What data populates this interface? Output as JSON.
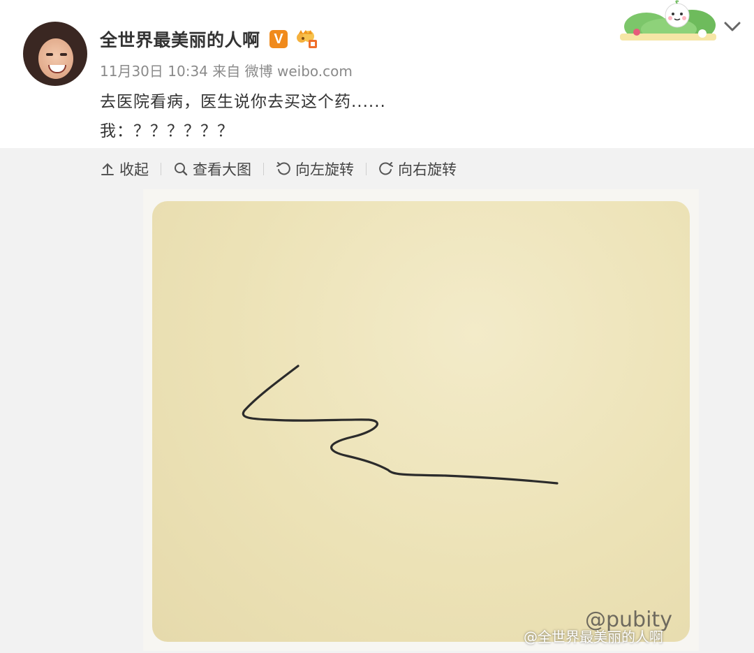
{
  "post": {
    "author_name": "全世界最美丽的人啊",
    "verified_badge": "V",
    "timestamp": "11月30日 10:34",
    "source": "来自 微博 weibo.com",
    "text_line1": "去医院看病，医生说你去买这个药......",
    "text_line2": "我：？？？？？？"
  },
  "toolbar": {
    "collapse_label": "收起",
    "view_large_label": "查看大图",
    "rotate_left_label": "向左旋转",
    "rotate_right_label": "向右旋转"
  },
  "image": {
    "watermark_pubity": "@pubity",
    "watermark_weibo": "@全世界最美丽的人啊"
  },
  "icons": {
    "verified": "v-badge-icon",
    "member": "crown-icon",
    "menu": "chevron-down-icon",
    "collapse": "collapse-up-icon",
    "search": "search-icon",
    "rotate_left": "rotate-left-icon",
    "rotate_right": "rotate-right-icon"
  },
  "colors": {
    "badge_orange": "#f08a1c",
    "meta_gray": "#8a8a8a",
    "media_bg": "#f2f2f2",
    "paper": "#ece2b6"
  }
}
